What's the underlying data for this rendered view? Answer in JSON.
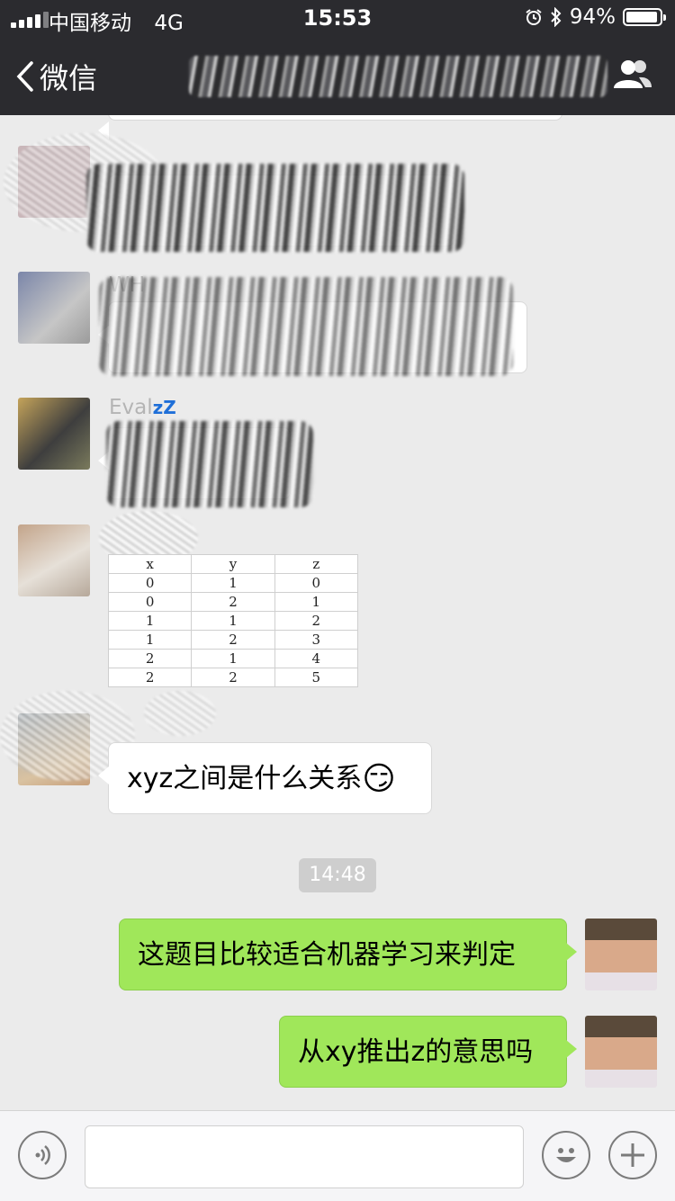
{
  "status_bar": {
    "carrier": "中国移动",
    "network": "4G",
    "time": "15:53",
    "battery": "94%",
    "battery_level": 0.94
  },
  "nav": {
    "back_label": "微信"
  },
  "messages": {
    "sender_wh": "WH",
    "sender_eval": "Eval",
    "sender_eval_zz": "zZ",
    "question": "xyz之间是什么关系",
    "timestamp": "14:48",
    "reply_1": "这题目比较适合机器学习来判定",
    "reply_2": "从xy推出z的意思吗"
  },
  "table_image": {
    "headers": [
      "x",
      "y",
      "z"
    ],
    "rows": [
      [
        "0",
        "1",
        "0"
      ],
      [
        "0",
        "2",
        "1"
      ],
      [
        "1",
        "1",
        "2"
      ],
      [
        "1",
        "2",
        "3"
      ],
      [
        "2",
        "1",
        "4"
      ],
      [
        "2",
        "2",
        "5"
      ]
    ]
  },
  "input_bar": {
    "value": ""
  },
  "colors": {
    "nav_bg": "#2b2b2f",
    "chat_bg": "#ebebeb",
    "own_bubble": "#a0e75a",
    "other_bubble": "#ffffff",
    "timestamp_bg": "#cecece"
  },
  "icons": [
    "back-chevron-icon",
    "group-info-icon",
    "alarm-icon",
    "bluetooth-icon",
    "voice-icon",
    "emoji-icon",
    "plus-icon",
    "smirk-emoji-icon"
  ]
}
